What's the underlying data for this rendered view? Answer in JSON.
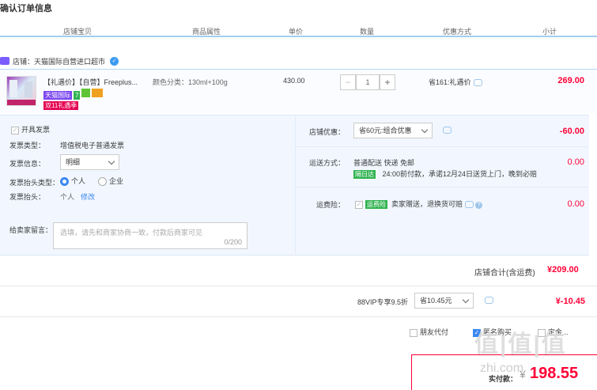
{
  "page_title": "确认订单信息",
  "columns": [
    "店铺宝贝",
    "商品属性",
    "单价",
    "数量",
    "优惠方式",
    "小计"
  ],
  "shop": {
    "label": "店铺：天猫国际自营进口超市"
  },
  "item": {
    "name": "【礼遇价】【自营】Freeplus...",
    "tags": [
      {
        "text": "天猫国际",
        "color": "#7a45f0"
      },
      {
        "text": "7",
        "color": "#30b350"
      },
      {
        "text": "",
        "color": "#5fc437"
      },
      {
        "text": "",
        "color": "#f0a020"
      }
    ],
    "tag2": "双11礼遇季",
    "attr": "颜色分类：130ml+100g",
    "price": "430.00",
    "qty": "1",
    "qty_minus": "−",
    "qty_plus": "+",
    "promo": "省161:礼遇价",
    "subtotal": "269.00",
    "thumb_caption": "FREEPLUS"
  },
  "invoice": {
    "open_label": "开具发票",
    "type_label": "发票类型：",
    "type_value": "增值税电子普通发票",
    "info_label": "发票信息：",
    "info_value": "明细",
    "head_type_label": "发票抬头类型：",
    "head_personal": "个人",
    "head_company": "企业",
    "head_label": "发票抬头：",
    "head_value": "个人",
    "head_edit": "修改"
  },
  "message": {
    "label": "给卖家留言：",
    "placeholder": "选填，请先和商家协商一致，付款后商家可见",
    "counter": "0/200"
  },
  "shop_discount": {
    "label": "店铺优惠：",
    "value": "省60元:组合优惠",
    "amount": "-60.00"
  },
  "delivery": {
    "label": "运送方式：",
    "value": "普通配送 快递 免邮",
    "badge": "隔日达",
    "note": "24:00前付款，承诺12月24日送货上门，晚到必赔",
    "amount": "0.00"
  },
  "insurance": {
    "label": "运费险：",
    "badge": "运费险",
    "value": "卖家赠送，退换货可赔",
    "amount": "0.00"
  },
  "shop_total": {
    "label": "店铺合计(含运费)",
    "amount": "¥209.00"
  },
  "vip": {
    "label": "88VIP专享9.5折",
    "value": "省10.45元",
    "amount": "¥-10.45"
  },
  "options": {
    "friend_pay": "朋友代付",
    "anonymous": "匿名购买",
    "gift": "定金..."
  },
  "pay": {
    "label": "实付款：",
    "amount": "198.55",
    "currency": "¥"
  },
  "watermark": "值|值|值",
  "watermark2": "zhi.com",
  "colors": {
    "accent": "#ff0036",
    "header_line": "#a2cef2",
    "panel_bg": "#f2f7ff"
  }
}
